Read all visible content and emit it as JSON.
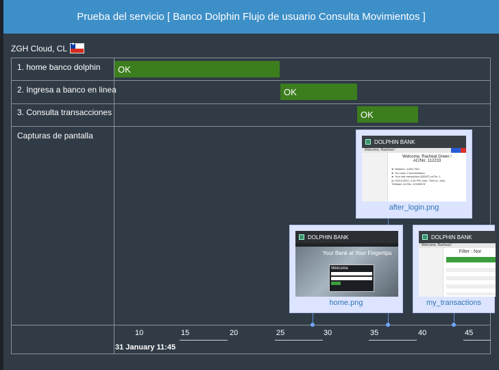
{
  "header": {
    "title": "Prueba del servicio [ Banco Dolphin Flujo de usuario Consulta Movimientos ]"
  },
  "location": {
    "label": "ZGH Cloud, CL",
    "flag": "chile-flag-icon"
  },
  "steps": [
    {
      "label": "1. home banco dolphin",
      "status": "OK"
    },
    {
      "label": "2. Ingresa a banco en linea",
      "status": "OK"
    },
    {
      "label": "3. Consulta transacciones",
      "status": "OK"
    }
  ],
  "screenshots": {
    "label": "Capturas de pantalla",
    "items": [
      {
        "caption": "after_login.png",
        "brand": "DOLPHIN BANK",
        "welcome_bar": "Welcome, Racheal !",
        "welcome": "Welcome, Racheal Green !",
        "ac": "AC/No: 112233",
        "lines": [
          "► Balance: 4,846,752/-",
          "► You have 2 beneficiaries.",
          "► Your last transaction (DEBIT) of Rs. 1",
          "on 31/01/2022, 2:45 PM, was: 'Sent to: Joey",
          "Tribbiani, AC/No: 12345678'"
        ]
      },
      {
        "caption": "home.png",
        "brand": "DOLPHIN BANK",
        "tagline": "Your Bank at Your Fingertips",
        "login": "Welcome"
      },
      {
        "caption": "my_transactions",
        "brand": "DOLPHIN BANK",
        "welcome_bar": "Welcome, Racheal !",
        "filter": "Filter : Nor"
      }
    ]
  },
  "timeline": {
    "ticks": [
      "10",
      "15",
      "20",
      "25",
      "30",
      "35",
      "40",
      "45"
    ],
    "date": "31 January 11:45"
  },
  "colors": {
    "header": "#3d8fc8",
    "ok_bar": "#3c7d1e",
    "caption": "#2e74b5"
  }
}
